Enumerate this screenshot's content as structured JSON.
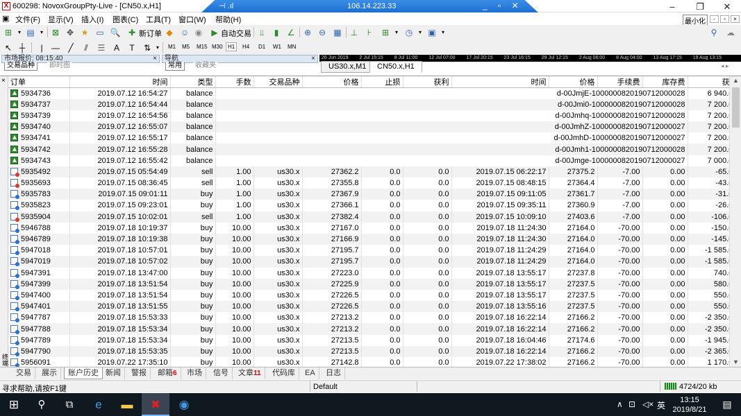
{
  "window": {
    "title": "600298: NovoxGroupPty-Live - [CN50.x,H1]",
    "server_ip": "106.14.223.33",
    "minimize_badge": "最小化"
  },
  "menu": [
    "文件(F)",
    "显示(V)",
    "插入(I)",
    "图表(C)",
    "工具(T)",
    "窗口(W)",
    "帮助(H)"
  ],
  "toolbar": {
    "new_order": "新订单",
    "auto_trade": "自动交易",
    "timeframes": [
      "M1",
      "M5",
      "M15",
      "M30",
      "H1",
      "H4",
      "D1",
      "W1",
      "MN"
    ],
    "active_timeframe": "H1"
  },
  "panes": {
    "market_watch": "市场报价: 08:15:40",
    "market_watch_tabs": [
      "交易品种",
      "即时图"
    ],
    "navigator": "导航",
    "navigator_tabs": [
      "常用",
      "收藏夹"
    ]
  },
  "timeline": [
    "26 Jun 2019",
    "2 Jul 15:15",
    "8 Jul 11:00",
    "12 Jul 07:00",
    "17 Jul 20:15",
    "23 Jul 16:15",
    "29 Jul 12:15",
    "2 Aug 06:00",
    "8 Aug 04:00",
    "13 Aug 17:15",
    "19 Aug 13:15"
  ],
  "chart_tabs": [
    "US30.x,M1",
    "CN50.x,H1"
  ],
  "table": {
    "columns": [
      "订单",
      "时间",
      "类型",
      "手数",
      "交易品种",
      "价格",
      "止损",
      "获利",
      "时间",
      "价格",
      "手续费",
      "库存费",
      "获利"
    ],
    "balance_rows": [
      {
        "order": "5934736",
        "time": "2019.07.12 16:54:27",
        "type": "balance",
        "comment": "d-00JmjE-1000000820190712000028",
        "profit": "6 940.00"
      },
      {
        "order": "5934737",
        "time": "2019.07.12 16:54:44",
        "type": "balance",
        "comment": "d-00Jmi0-1000000820190712000028",
        "profit": "7 200.00"
      },
      {
        "order": "5934739",
        "time": "2019.07.12 16:54:56",
        "type": "balance",
        "comment": "d-00Jmhq-1000000820190712000028",
        "profit": "7 200.00"
      },
      {
        "order": "5934740",
        "time": "2019.07.12 16:55:07",
        "type": "balance",
        "comment": "d-00JmhZ-1000000820190712000027",
        "profit": "7 200.00"
      },
      {
        "order": "5934741",
        "time": "2019.07.12 16:55:17",
        "type": "balance",
        "comment": "d-00JmhD-1000000820190712000027",
        "profit": "7 200.00"
      },
      {
        "order": "5934742",
        "time": "2019.07.12 16:55:28",
        "type": "balance",
        "comment": "d-00Jmh1-1000000820190712000028",
        "profit": "7 200.00"
      },
      {
        "order": "5934743",
        "time": "2019.07.12 16:55:42",
        "type": "balance",
        "comment": "d-00Jmge-1000000820190712000027",
        "profit": "7 000.00"
      }
    ],
    "trade_rows": [
      {
        "order": "5935492",
        "time": "2019.07.15 05:54:49",
        "type": "sell",
        "lots": "1.00",
        "symbol": "us30.x",
        "price": "27362.2",
        "sl": "0.0",
        "tp": "0.0",
        "close_time": "2019.07.15 06:22:17",
        "close_price": "27375.2",
        "commission": "-7.00",
        "swap": "0.00",
        "profit": "-65.00"
      },
      {
        "order": "5935693",
        "time": "2019.07.15 08:36:45",
        "type": "sell",
        "lots": "1.00",
        "symbol": "us30.x",
        "price": "27355.8",
        "sl": "0.0",
        "tp": "0.0",
        "close_time": "2019.07.15 08:48:15",
        "close_price": "27364.4",
        "commission": "-7.00",
        "swap": "0.00",
        "profit": "-43.00"
      },
      {
        "order": "5935783",
        "time": "2019.07.15 09:01:11",
        "type": "buy",
        "lots": "1.00",
        "symbol": "us30.x",
        "price": "27367.9",
        "sl": "0.0",
        "tp": "0.0",
        "close_time": "2019.07.15 09:11:05",
        "close_price": "27361.7",
        "commission": "-7.00",
        "swap": "0.00",
        "profit": "-31.00"
      },
      {
        "order": "5935823",
        "time": "2019.07.15 09:23:01",
        "type": "buy",
        "lots": "1.00",
        "symbol": "us30.x",
        "price": "27366.1",
        "sl": "0.0",
        "tp": "0.0",
        "close_time": "2019.07.15 09:35:11",
        "close_price": "27360.9",
        "commission": "-7.00",
        "swap": "0.00",
        "profit": "-26.00"
      },
      {
        "order": "5935904",
        "time": "2019.07.15 10:02:01",
        "type": "sell",
        "lots": "1.00",
        "symbol": "us30.x",
        "price": "27382.4",
        "sl": "0.0",
        "tp": "0.0",
        "close_time": "2019.07.15 10:09:10",
        "close_price": "27403.6",
        "commission": "-7.00",
        "swap": "0.00",
        "profit": "-106.00"
      },
      {
        "order": "5946788",
        "time": "2019.07.18 10:19:37",
        "type": "buy",
        "lots": "10.00",
        "symbol": "us30.x",
        "price": "27167.0",
        "sl": "0.0",
        "tp": "0.0",
        "close_time": "2019.07.18 11:24:30",
        "close_price": "27164.0",
        "commission": "-70.00",
        "swap": "0.00",
        "profit": "-150.00"
      },
      {
        "order": "5946789",
        "time": "2019.07.18 10:19:38",
        "type": "buy",
        "lots": "10.00",
        "symbol": "us30.x",
        "price": "27166.9",
        "sl": "0.0",
        "tp": "0.0",
        "close_time": "2019.07.18 11:24:30",
        "close_price": "27164.0",
        "commission": "-70.00",
        "swap": "0.00",
        "profit": "-145.00"
      },
      {
        "order": "5947018",
        "time": "2019.07.18 10:57:01",
        "type": "buy",
        "lots": "10.00",
        "symbol": "us30.x",
        "price": "27195.7",
        "sl": "0.0",
        "tp": "0.0",
        "close_time": "2019.07.18 11:24:29",
        "close_price": "27164.0",
        "commission": "-70.00",
        "swap": "0.00",
        "profit": "-1 585.00"
      },
      {
        "order": "5947019",
        "time": "2019.07.18 10:57:02",
        "type": "buy",
        "lots": "10.00",
        "symbol": "us30.x",
        "price": "27195.7",
        "sl": "0.0",
        "tp": "0.0",
        "close_time": "2019.07.18 11:24:29",
        "close_price": "27164.0",
        "commission": "-70.00",
        "swap": "0.00",
        "profit": "-1 585.00"
      },
      {
        "order": "5947391",
        "time": "2019.07.18 13:47:00",
        "type": "buy",
        "lots": "10.00",
        "symbol": "us30.x",
        "price": "27223.0",
        "sl": "0.0",
        "tp": "0.0",
        "close_time": "2019.07.18 13:55:17",
        "close_price": "27237.8",
        "commission": "-70.00",
        "swap": "0.00",
        "profit": "740.00"
      },
      {
        "order": "5947399",
        "time": "2019.07.18 13:51:54",
        "type": "buy",
        "lots": "10.00",
        "symbol": "us30.x",
        "price": "27225.9",
        "sl": "0.0",
        "tp": "0.0",
        "close_time": "2019.07.18 13:55:17",
        "close_price": "27237.5",
        "commission": "-70.00",
        "swap": "0.00",
        "profit": "580.00"
      },
      {
        "order": "5947400",
        "time": "2019.07.18 13:51:54",
        "type": "buy",
        "lots": "10.00",
        "symbol": "us30.x",
        "price": "27226.5",
        "sl": "0.0",
        "tp": "0.0",
        "close_time": "2019.07.18 13:55:17",
        "close_price": "27237.5",
        "commission": "-70.00",
        "swap": "0.00",
        "profit": "550.00"
      },
      {
        "order": "5947401",
        "time": "2019.07.18 13:51:55",
        "type": "buy",
        "lots": "10.00",
        "symbol": "us30.x",
        "price": "27226.5",
        "sl": "0.0",
        "tp": "0.0",
        "close_time": "2019.07.18 13:55:16",
        "close_price": "27237.5",
        "commission": "-70.00",
        "swap": "0.00",
        "profit": "550.00"
      },
      {
        "order": "5947787",
        "time": "2019.07.18 15:53:33",
        "type": "buy",
        "lots": "10.00",
        "symbol": "us30.x",
        "price": "27213.2",
        "sl": "0.0",
        "tp": "0.0",
        "close_time": "2019.07.18 16:22:14",
        "close_price": "27166.2",
        "commission": "-70.00",
        "swap": "0.00",
        "profit": "-2 350.00"
      },
      {
        "order": "5947788",
        "time": "2019.07.18 15:53:34",
        "type": "buy",
        "lots": "10.00",
        "symbol": "us30.x",
        "price": "27213.2",
        "sl": "0.0",
        "tp": "0.0",
        "close_time": "2019.07.18 16:22:14",
        "close_price": "27166.2",
        "commission": "-70.00",
        "swap": "0.00",
        "profit": "-2 350.00"
      },
      {
        "order": "5947789",
        "time": "2019.07.18 15:53:34",
        "type": "buy",
        "lots": "10.00",
        "symbol": "us30.x",
        "price": "27213.5",
        "sl": "0.0",
        "tp": "0.0",
        "close_time": "2019.07.18 16:04:46",
        "close_price": "27174.6",
        "commission": "-70.00",
        "swap": "0.00",
        "profit": "-1 945.00"
      },
      {
        "order": "5947790",
        "time": "2019.07.18 15:53:35",
        "type": "buy",
        "lots": "10.00",
        "symbol": "us30.x",
        "price": "27213.5",
        "sl": "0.0",
        "tp": "0.0",
        "close_time": "2019.07.18 16:22:14",
        "close_price": "27166.2",
        "commission": "-70.00",
        "swap": "0.00",
        "profit": "-2 365.00"
      },
      {
        "order": "5956091",
        "time": "2019.07.22 17:35:10",
        "type": "buy",
        "lots": "10.00",
        "symbol": "us30.x",
        "price": "27142.8",
        "sl": "0.0",
        "tp": "0.0",
        "close_time": "2019.07.22 17:38:02",
        "close_price": "27166.2",
        "commission": "-70.00",
        "swap": "0.00",
        "profit": "1 170.00"
      }
    ]
  },
  "terminal_label": "终端",
  "bottom_tabs": [
    {
      "label": "交易",
      "count": ""
    },
    {
      "label": "展示",
      "count": ""
    },
    {
      "label": "账户历史",
      "count": ""
    },
    {
      "label": "新闻",
      "count": ""
    },
    {
      "label": "警报",
      "count": ""
    },
    {
      "label": "邮箱",
      "count": "6"
    },
    {
      "label": "市场",
      "count": ""
    },
    {
      "label": "信号",
      "count": ""
    },
    {
      "label": "文章",
      "count": "11"
    },
    {
      "label": "代码库",
      "count": ""
    },
    {
      "label": "EA",
      "count": ""
    },
    {
      "label": "日志",
      "count": ""
    }
  ],
  "active_bottom_tab": "账户历史",
  "status": {
    "help": "寻求帮助,请按F1键",
    "profile": "Default",
    "traffic": "4724/20 kb"
  },
  "taskbar": {
    "time": "13:15",
    "date": "2019/8/21",
    "ime": "英"
  }
}
